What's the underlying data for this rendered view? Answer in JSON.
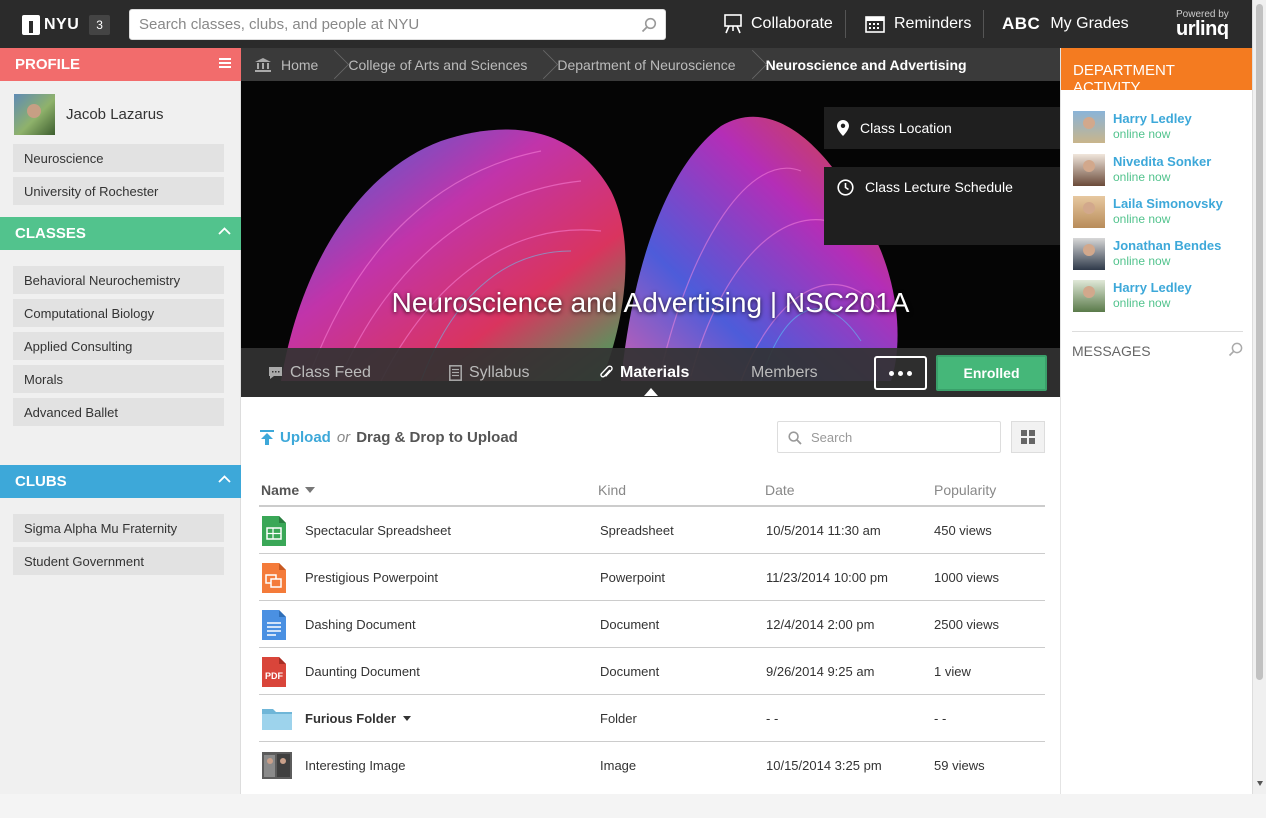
{
  "topbar": {
    "brand": "NYU",
    "notification_count": "3",
    "search_placeholder": "Search classes, clubs, and people at NYU",
    "nav": [
      {
        "label": "Collaborate",
        "icon": "easel-icon"
      },
      {
        "label": "Reminders",
        "icon": "calendar-icon"
      },
      {
        "label": "My Grades",
        "icon": "abc-icon",
        "prefix": "ABC"
      }
    ],
    "powered_by": "Powered by",
    "powered_brand": "urlinq"
  },
  "profile": {
    "header": "PROFILE",
    "name": "Jacob Lazarus",
    "items": [
      "Neuroscience",
      "University of Rochester"
    ]
  },
  "classes": {
    "header": "CLASSES",
    "items": [
      "Behavioral Neurochemistry",
      "Computational Biology",
      "Applied Consulting",
      "Morals",
      "Advanced Ballet"
    ]
  },
  "clubs": {
    "header": "CLUBS",
    "items": [
      "Sigma Alpha Mu Fraternity",
      "Student Government"
    ]
  },
  "breadcrumbs": [
    "Home",
    "College of Arts and Sciences",
    "Department of Neuroscience",
    "Neuroscience and Advertising"
  ],
  "hero": {
    "title": "Neuroscience and Advertising | NSC201A",
    "location_label": "Class Location",
    "schedule_label": "Class Lecture Schedule"
  },
  "tabs": [
    {
      "label": "Class Feed",
      "icon": "chat-icon"
    },
    {
      "label": "Syllabus",
      "icon": "document-icon"
    },
    {
      "label": "Materials",
      "icon": "paperclip-icon",
      "active": true
    },
    {
      "label": "Members",
      "icon": ""
    }
  ],
  "enrolled_label": "Enrolled",
  "materials": {
    "upload_label": "Upload",
    "or_label": "or",
    "dragdrop_label": "Drag & Drop to Upload",
    "search_placeholder": "Search",
    "columns": [
      "Name",
      "Kind",
      "Date",
      "Popularity"
    ],
    "rows": [
      {
        "name": "Spectacular Spreadsheet",
        "kind": "Spreadsheet",
        "date": "10/5/2014 11:30 am",
        "popularity": "450 views",
        "icon": "spreadsheet-icon",
        "color": "#3aa757"
      },
      {
        "name": "Prestigious Powerpoint",
        "kind": "Powerpoint",
        "date": "11/23/2014 10:00 pm",
        "popularity": "1000 views",
        "icon": "presentation-icon",
        "color": "#f47b3a"
      },
      {
        "name": "Dashing Document",
        "kind": "Document",
        "date": "12/4/2014 2:00 pm",
        "popularity": "2500 views",
        "icon": "document-icon",
        "color": "#4a90e2"
      },
      {
        "name": "Daunting Document",
        "kind": "Document",
        "date": "9/26/2014 9:25 am",
        "popularity": "1 view",
        "icon": "pdf-icon",
        "color": "#d9453a",
        "badge": "PDF"
      },
      {
        "name": "Furious Folder",
        "kind": "Folder",
        "date": "- -",
        "popularity": "- -",
        "icon": "folder-icon",
        "color": "#8fcbe6",
        "bold": true
      },
      {
        "name": "Interesting Image",
        "kind": "Image",
        "date": "10/15/2014 3:25 pm",
        "popularity": "59 views",
        "icon": "image-thumbnail-icon",
        "color": "#6b6b6b"
      }
    ]
  },
  "activity": {
    "header": "DEPARTMENT ACTIVITY",
    "people": [
      {
        "name": "Harry Ledley",
        "status": "online now"
      },
      {
        "name": "Nivedita Sonker",
        "status": "online now"
      },
      {
        "name": "Laila Simonovsky",
        "status": "online now"
      },
      {
        "name": "Jonathan Bendes",
        "status": "online now"
      },
      {
        "name": "Harry Ledley",
        "status": "online now"
      }
    ],
    "messages_label": "MESSAGES"
  },
  "colors": {
    "profile": "#f26c6c",
    "classes": "#52c38d",
    "clubs": "#3da8d9",
    "activity": "#f47b20",
    "enrolled": "#45b779"
  }
}
